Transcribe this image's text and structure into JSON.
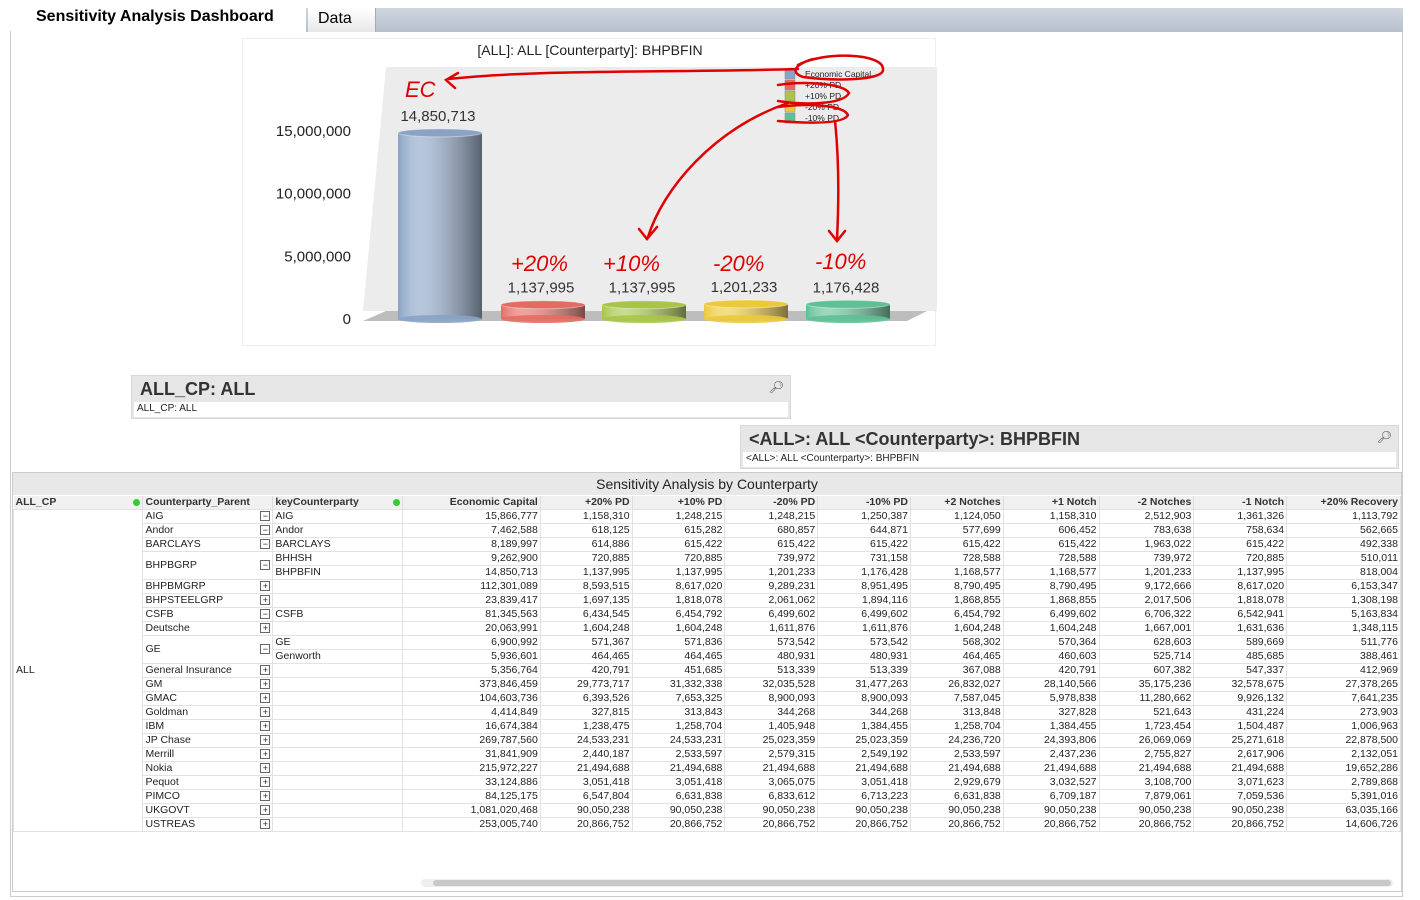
{
  "tabs": [
    {
      "label": "Sensitivity Analysis Dashboard",
      "active": true
    },
    {
      "label": "Data",
      "active": false
    }
  ],
  "chart": {
    "title": "[ALL]: ALL [Counterparty]: BHPBFIN",
    "legend": [
      "Economic Capital",
      "+20% PD",
      "+10% PD",
      "-20% PD",
      "-10% PD"
    ],
    "annotations": [
      "EC",
      "+20%",
      "+10%",
      "-20%",
      "-10%"
    ],
    "annotation_color": "#e00000"
  },
  "chart_data": {
    "type": "bar",
    "title": "[ALL]: ALL [Counterparty]: BHPBFIN",
    "categories": [
      "Economic Capital",
      "+20% PD",
      "+10% PD",
      "-20% PD",
      "-10% PD"
    ],
    "values": [
      14850713,
      1137995,
      1137995,
      1201233,
      1176428
    ],
    "value_labels": [
      "14,850,713",
      "1,137,995",
      "1,137,995",
      "1,201,233",
      "1,176,428"
    ],
    "colors": [
      "#8aa3c4",
      "#e46b62",
      "#a8c548",
      "#ecc93a",
      "#5fbf95"
    ],
    "yticks": [
      "0",
      "5,000,000",
      "10,000,000",
      "15,000,000"
    ],
    "ylim": [
      0,
      15000000
    ],
    "legend_position": "top-right"
  },
  "listbox1": {
    "caption": "ALL_CP: ALL",
    "current": "ALL_CP: ALL"
  },
  "listbox2": {
    "caption": "<ALL>: ALL <Counterparty>: BHPBFIN",
    "current": "<ALL>: ALL <Counterparty>: BHPBFIN"
  },
  "table": {
    "title": "Sensitivity Analysis by Counterparty",
    "all_cp_value": "ALL",
    "headers": [
      "ALL_CP",
      "Counterparty_Parent",
      "keyCounterparty",
      "Economic Capital",
      "+20% PD",
      "+10% PD",
      "-20% PD",
      "-10% PD",
      "+2 Notches",
      "+1 Notch",
      "-2 Notches",
      "-1 Notch",
      "+20% Recovery"
    ],
    "rows": [
      {
        "parent": "AIG",
        "exp": "-",
        "key": "AIG",
        "v": [
          "15,866,777",
          "1,158,310",
          "1,248,215",
          "1,248,215",
          "1,250,387",
          "1,124,050",
          "1,158,310",
          "2,512,903",
          "1,361,326",
          "1,113,792"
        ]
      },
      {
        "parent": "Andor",
        "exp": "-",
        "key": "Andor",
        "v": [
          "7,462,588",
          "618,125",
          "615,282",
          "680,857",
          "644,871",
          "577,699",
          "606,452",
          "783,638",
          "758,634",
          "562,665"
        ]
      },
      {
        "parent": "BARCLAYS",
        "exp": "-",
        "key": "BARCLAYS",
        "v": [
          "8,189,997",
          "614,886",
          "615,422",
          "615,422",
          "615,422",
          "615,422",
          "615,422",
          "1,963,022",
          "615,422",
          "492,338"
        ]
      },
      {
        "parent": "BHPBGRP",
        "exp": "-",
        "span": 2,
        "key": "BHHSH",
        "v": [
          "9,262,900",
          "720,885",
          "720,885",
          "739,972",
          "731,158",
          "728,588",
          "728,588",
          "739,972",
          "720,885",
          "510,011"
        ]
      },
      {
        "key": "BHPBFIN",
        "v": [
          "14,850,713",
          "1,137,995",
          "1,137,995",
          "1,201,233",
          "1,176,428",
          "1,168,577",
          "1,168,577",
          "1,201,233",
          "1,137,995",
          "818,004"
        ]
      },
      {
        "parent": "BHPBMGRP",
        "exp": "+",
        "key": "",
        "v": [
          "112,301,089",
          "8,593,515",
          "8,617,020",
          "9,289,231",
          "8,951,495",
          "8,790,495",
          "8,790,495",
          "9,172,666",
          "8,617,020",
          "6,153,347"
        ]
      },
      {
        "parent": "BHPSTEELGRP",
        "exp": "+",
        "key": "",
        "v": [
          "23,839,417",
          "1,697,135",
          "1,818,078",
          "2,061,062",
          "1,894,116",
          "1,868,855",
          "1,868,855",
          "2,017,506",
          "1,818,078",
          "1,308,198"
        ]
      },
      {
        "parent": "CSFB",
        "exp": "-",
        "key": "CSFB",
        "v": [
          "81,345,563",
          "6,434,545",
          "6,454,792",
          "6,499,602",
          "6,499,602",
          "6,454,792",
          "6,499,602",
          "6,706,322",
          "6,542,941",
          "5,163,834"
        ]
      },
      {
        "parent": "Deutsche",
        "exp": "+",
        "key": "",
        "v": [
          "20,063,991",
          "1,604,248",
          "1,604,248",
          "1,611,876",
          "1,611,876",
          "1,604,248",
          "1,604,248",
          "1,667,001",
          "1,631,636",
          "1,348,115"
        ]
      },
      {
        "parent": "GE",
        "exp": "-",
        "span": 2,
        "key": "GE",
        "v": [
          "6,900,992",
          "571,367",
          "571,836",
          "573,542",
          "573,542",
          "568,302",
          "570,364",
          "628,603",
          "589,669",
          "511,776"
        ]
      },
      {
        "key": "Genworth",
        "v": [
          "5,936,601",
          "464,465",
          "464,465",
          "480,931",
          "480,931",
          "464,465",
          "460,603",
          "525,714",
          "485,685",
          "388,461"
        ]
      },
      {
        "parent": "General Insurance",
        "exp": "+",
        "key": "",
        "v": [
          "5,356,764",
          "420,791",
          "451,685",
          "513,339",
          "513,339",
          "367,088",
          "420,791",
          "607,382",
          "547,337",
          "412,969"
        ]
      },
      {
        "parent": "GM",
        "exp": "+",
        "key": "",
        "v": [
          "373,846,459",
          "29,773,717",
          "31,332,338",
          "32,035,528",
          "31,477,263",
          "26,832,027",
          "28,140,566",
          "35,175,236",
          "32,578,675",
          "27,378,265"
        ]
      },
      {
        "parent": "GMAC",
        "exp": "+",
        "key": "",
        "v": [
          "104,603,736",
          "6,393,526",
          "7,653,325",
          "8,900,093",
          "8,900,093",
          "7,587,045",
          "5,978,838",
          "11,280,662",
          "9,926,132",
          "7,641,235"
        ]
      },
      {
        "parent": "Goldman",
        "exp": "+",
        "key": "",
        "v": [
          "4,414,849",
          "327,815",
          "313,843",
          "344,268",
          "344,268",
          "313,848",
          "327,828",
          "521,643",
          "431,224",
          "273,903"
        ]
      },
      {
        "parent": "IBM",
        "exp": "+",
        "key": "",
        "v": [
          "16,674,384",
          "1,238,475",
          "1,258,704",
          "1,405,948",
          "1,384,455",
          "1,258,704",
          "1,384,455",
          "1,723,454",
          "1,504,487",
          "1,006,963"
        ]
      },
      {
        "parent": "JP Chase",
        "exp": "+",
        "key": "",
        "v": [
          "269,787,560",
          "24,533,231",
          "24,533,231",
          "25,023,359",
          "25,023,359",
          "24,236,720",
          "24,393,806",
          "26,069,069",
          "25,271,618",
          "22,878,500"
        ]
      },
      {
        "parent": "Merrill",
        "exp": "+",
        "key": "",
        "v": [
          "31,841,909",
          "2,440,187",
          "2,533,597",
          "2,579,315",
          "2,549,192",
          "2,533,597",
          "2,437,236",
          "2,755,827",
          "2,617,906",
          "2,132,051"
        ]
      },
      {
        "parent": "Nokia",
        "exp": "+",
        "key": "",
        "v": [
          "215,972,227",
          "21,494,688",
          "21,494,688",
          "21,494,688",
          "21,494,688",
          "21,494,688",
          "21,494,688",
          "21,494,688",
          "21,494,688",
          "19,652,286"
        ]
      },
      {
        "parent": "Pequot",
        "exp": "+",
        "key": "",
        "v": [
          "33,124,886",
          "3,051,418",
          "3,051,418",
          "3,065,075",
          "3,051,418",
          "2,929,679",
          "3,032,527",
          "3,108,700",
          "3,071,623",
          "2,789,868"
        ]
      },
      {
        "parent": "PIMCO",
        "exp": "+",
        "key": "",
        "v": [
          "84,125,175",
          "6,547,804",
          "6,631,838",
          "6,833,612",
          "6,713,223",
          "6,631,838",
          "6,709,187",
          "7,879,061",
          "7,059,536",
          "5,391,016"
        ]
      },
      {
        "parent": "UKGOVT",
        "exp": "+",
        "key": "",
        "v": [
          "1,081,020,468",
          "90,050,238",
          "90,050,238",
          "90,050,238",
          "90,050,238",
          "90,050,238",
          "90,050,238",
          "90,050,238",
          "90,050,238",
          "63,035,166"
        ]
      },
      {
        "parent": "USTREAS",
        "exp": "+",
        "key": "",
        "v": [
          "253,005,740",
          "20,866,752",
          "20,866,752",
          "20,866,752",
          "20,866,752",
          "20,866,752",
          "20,866,752",
          "20,866,752",
          "20,866,752",
          "14,606,726"
        ]
      }
    ]
  }
}
